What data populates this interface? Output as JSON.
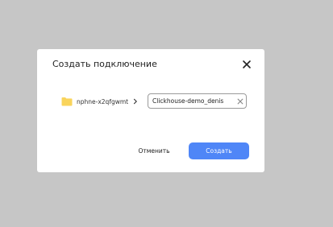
{
  "dialog": {
    "title": "Создать подключение",
    "close_icon": "close-icon"
  },
  "breadcrumb": {
    "folder_icon": "folder-icon",
    "folder_label": "nphne-x2qfgwmt",
    "separator_icon": "chevron-right-icon"
  },
  "name_field": {
    "value": "Clickhouse-demo_denis",
    "clear_icon": "clear-icon"
  },
  "actions": {
    "cancel_label": "Отменить",
    "create_label": "Создать"
  },
  "colors": {
    "overlay": "#c6c6c6",
    "primary": "#4f86f7",
    "folder": "#f9d45c"
  }
}
